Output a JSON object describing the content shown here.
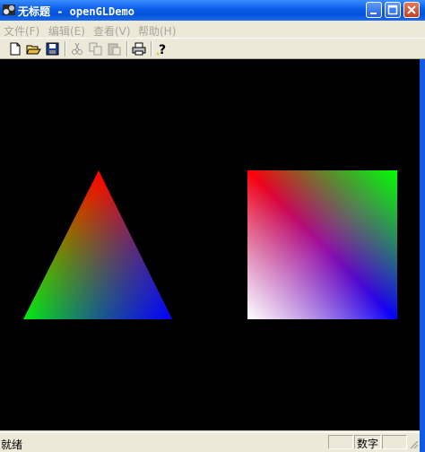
{
  "window": {
    "title": "无标题 - openGLDemo"
  },
  "menu": [
    {
      "label": "文件(F)"
    },
    {
      "label": "编辑(E)"
    },
    {
      "label": "查看(V)"
    },
    {
      "label": "帮助(H)"
    }
  ],
  "toolbar": {
    "items": [
      "new-file-icon",
      "open-folder-icon",
      "save-disk-icon",
      "cut-icon",
      "copy-icon",
      "paste-icon",
      "print-icon",
      "help-icon"
    ]
  },
  "statusbar": {
    "text": "就绪",
    "num_indicator": "数字"
  },
  "colors": {
    "canvas": "#000000",
    "titlebar": "#0A5CE8",
    "chrome": "#ECE9D8",
    "menu_disabled": "#A8A69B"
  }
}
